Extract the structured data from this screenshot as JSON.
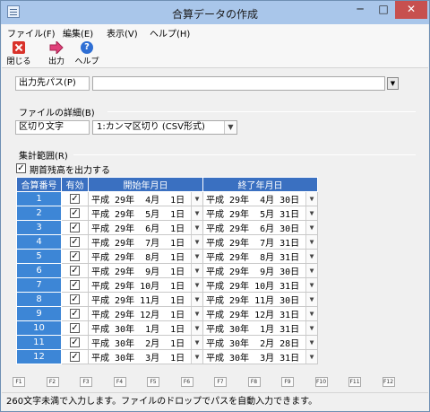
{
  "window": {
    "title": "合算データの作成",
    "min_glyph": "─",
    "max_glyph": "□",
    "close_glyph": "✕"
  },
  "menu": [
    "ファイル(F)",
    "編集(E)",
    "表示(V)",
    "ヘルプ(H)"
  ],
  "toolbar": {
    "close_label": "閉じる",
    "output_label": "出力",
    "help_label": "ヘルプ"
  },
  "output_path": {
    "label": "出力先パス(P)",
    "value": "",
    "dropdown_glyph": "▼"
  },
  "file_details": {
    "section_label": "ファイルの詳細(B)",
    "delimiter_label": "区切り文字",
    "delimiter_value": "1:カンマ区切り (CSV形式)"
  },
  "range": {
    "section_label": "集計範囲(R)",
    "opening_balance_label": "期首残高を出力する",
    "opening_balance_checked": true
  },
  "table": {
    "headers": [
      "合算番号",
      "有効",
      "開始年月日",
      "終了年月日"
    ],
    "rows": [
      {
        "num": "1",
        "enabled": true,
        "start": "平成 29年  4月  1日",
        "end": "平成 29年  4月 30日"
      },
      {
        "num": "2",
        "enabled": true,
        "start": "平成 29年  5月  1日",
        "end": "平成 29年  5月 31日"
      },
      {
        "num": "3",
        "enabled": true,
        "start": "平成 29年  6月  1日",
        "end": "平成 29年  6月 30日"
      },
      {
        "num": "4",
        "enabled": true,
        "start": "平成 29年  7月  1日",
        "end": "平成 29年  7月 31日"
      },
      {
        "num": "5",
        "enabled": true,
        "start": "平成 29年  8月  1日",
        "end": "平成 29年  8月 31日"
      },
      {
        "num": "6",
        "enabled": true,
        "start": "平成 29年  9月  1日",
        "end": "平成 29年  9月 30日"
      },
      {
        "num": "7",
        "enabled": true,
        "start": "平成 29年 10月  1日",
        "end": "平成 29年 10月 31日"
      },
      {
        "num": "8",
        "enabled": true,
        "start": "平成 29年 11月  1日",
        "end": "平成 29年 11月 30日"
      },
      {
        "num": "9",
        "enabled": true,
        "start": "平成 29年 12月  1日",
        "end": "平成 29年 12月 31日"
      },
      {
        "num": "10",
        "enabled": true,
        "start": "平成 30年  1月  1日",
        "end": "平成 30年  1月 31日"
      },
      {
        "num": "11",
        "enabled": true,
        "start": "平成 30年  2月  1日",
        "end": "平成 30年  2月 28日"
      },
      {
        "num": "12",
        "enabled": true,
        "start": "平成 30年  3月  1日",
        "end": "平成 30年  3月 31日"
      }
    ]
  },
  "fkeys": [
    "F1",
    "F2",
    "F3",
    "F4",
    "F5",
    "F6",
    "F7",
    "F8",
    "F9",
    "F10",
    "F11",
    "F12"
  ],
  "status": "260文字未満で入力します。ファイルのドロップでパスを自動入力できます。",
  "colors": {
    "header_bg": "#3a70c1",
    "num_bg": "#3d86d6",
    "close_btn": "#c7504f"
  }
}
